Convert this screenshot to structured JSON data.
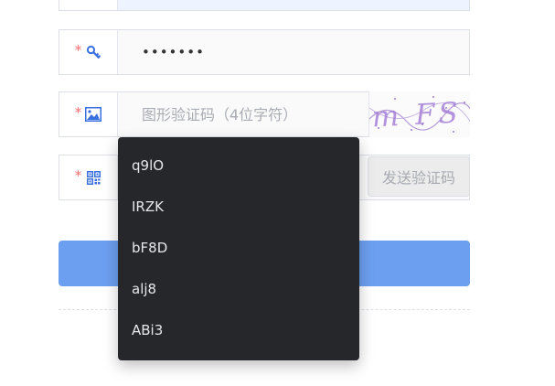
{
  "top_field": {
    "value": ""
  },
  "password": {
    "required_mark": "*",
    "icon": "key-icon",
    "value": "•••••••"
  },
  "captcha": {
    "required_mark": "*",
    "icon": "image-icon",
    "placeholder": "图形验证码（4位字符）",
    "image_text": "m FS"
  },
  "sms": {
    "required_mark": "*",
    "icon": "qrcode-icon",
    "send_label": "发送验证码"
  },
  "autocomplete": {
    "options": [
      "q9lO",
      "IRZK",
      "bF8D",
      "alj8",
      "ABi3"
    ]
  },
  "colors": {
    "accent": "#6c9ff0",
    "required": "#f56c6c",
    "icon": "#3a6fe0",
    "dropdown_bg": "#26272b"
  }
}
